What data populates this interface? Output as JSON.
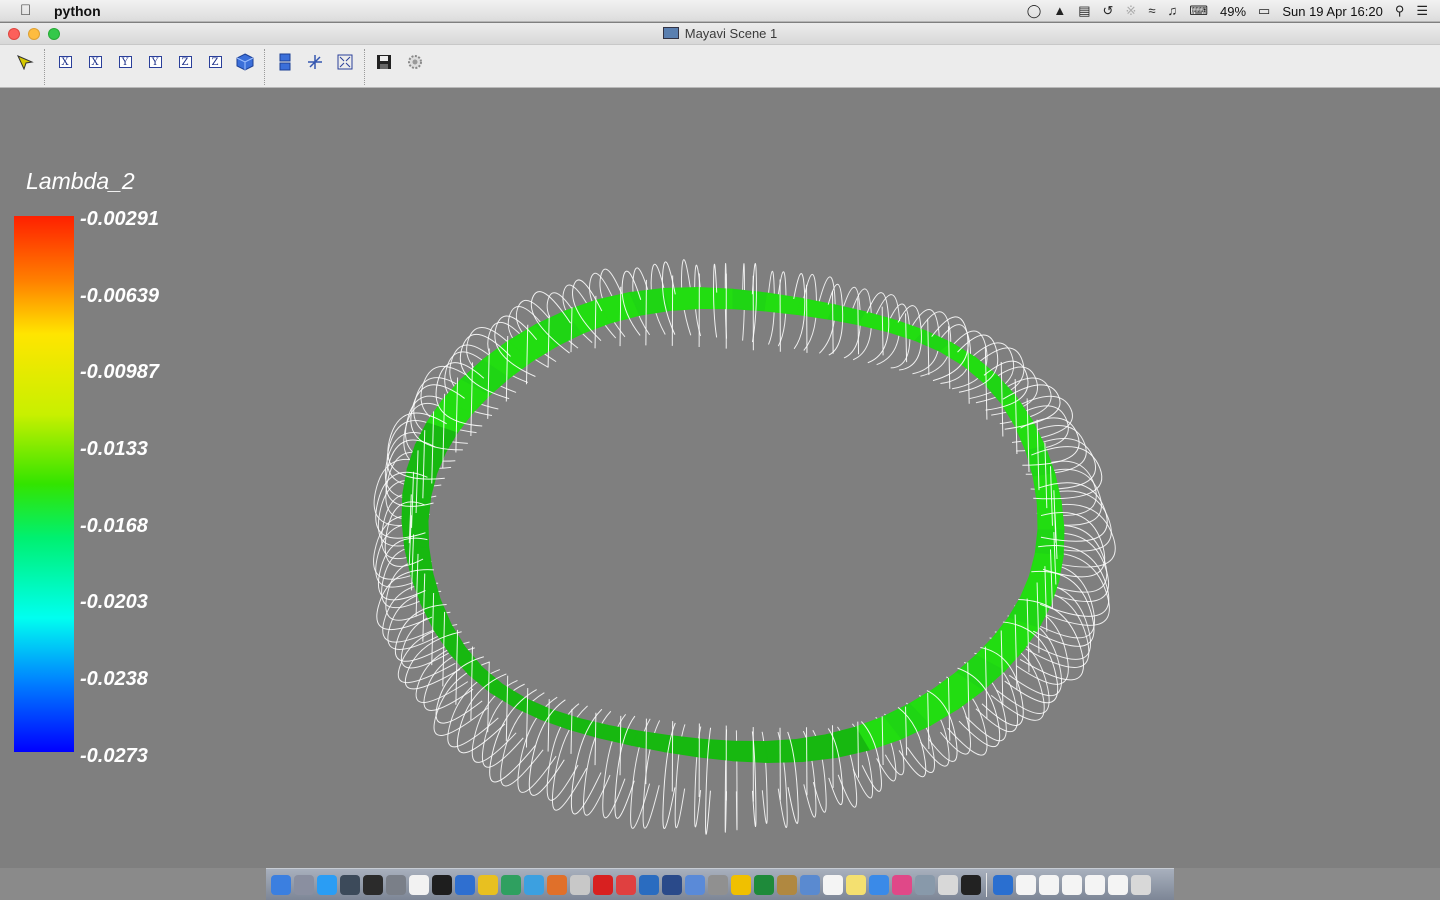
{
  "menubar": {
    "apple_icon": "apple-icon",
    "app_name": "python",
    "battery": "49%",
    "datetime": "Sun 19 Apr  16:20",
    "status_icons": [
      "sync-icon",
      "drive-icon",
      "memory-icon",
      "time-machine-icon",
      "bluetooth-icon",
      "wifi-icon",
      "volume-icon",
      "keyboard-input-icon",
      "battery-icon",
      "spotlight-icon",
      "notifications-icon"
    ]
  },
  "window": {
    "title": "Mayavi Scene 1"
  },
  "toolbar": {
    "buttons": [
      {
        "name": "interaction-mode-icon"
      },
      {
        "name": "view-x-pos-icon",
        "label": "X"
      },
      {
        "name": "view-x-neg-icon",
        "label": "X"
      },
      {
        "name": "view-y-pos-icon",
        "label": "Y"
      },
      {
        "name": "view-y-neg-icon",
        "label": "Y"
      },
      {
        "name": "view-z-pos-icon",
        "label": "Z"
      },
      {
        "name": "view-z-neg-icon",
        "label": "Z"
      },
      {
        "name": "isometric-view-icon"
      },
      {
        "name": "parallel-projection-icon"
      },
      {
        "name": "axes-toggle-icon"
      },
      {
        "name": "full-screen-icon"
      },
      {
        "name": "save-icon"
      },
      {
        "name": "configure-icon"
      }
    ]
  },
  "scene": {
    "colorbar": {
      "title": "Lambda_2",
      "labels": [
        "-0.00291",
        "-0.00639",
        "-0.00987",
        "-0.0133",
        "-0.0168",
        "-0.0203",
        "-0.0238",
        "-0.0273"
      ],
      "colors": [
        "#ff2000",
        "#ff7f00",
        "#ffe500",
        "#c8f000",
        "#33e400",
        "#00f070",
        "#00fff0",
        "#0080ff",
        "#0000ff"
      ]
    },
    "tube_color": "#22dd11",
    "streamline_color": "#ffffff",
    "background": "#7f7f7f"
  },
  "dock": {
    "apps": [
      "finder",
      "launchpad",
      "app-store",
      "mission-control",
      "activity-monitor",
      "system-preferences",
      "textedit",
      "terminal",
      "xquartz",
      "wolfram",
      "anaconda",
      "rgb-tool",
      "matlab",
      "gaussian",
      "acrobat",
      "sketchup",
      "virtualbox",
      "screen-sharing",
      "xcode",
      "ads",
      "scratch",
      "excel",
      "bridge",
      "preview",
      "calendar",
      "notes",
      "safari",
      "itunes",
      "paraview",
      "mail",
      "console",
      "downloads",
      "documents",
      "folder-1",
      "folder-2",
      "folder-3",
      "folder-4",
      "trash"
    ]
  }
}
